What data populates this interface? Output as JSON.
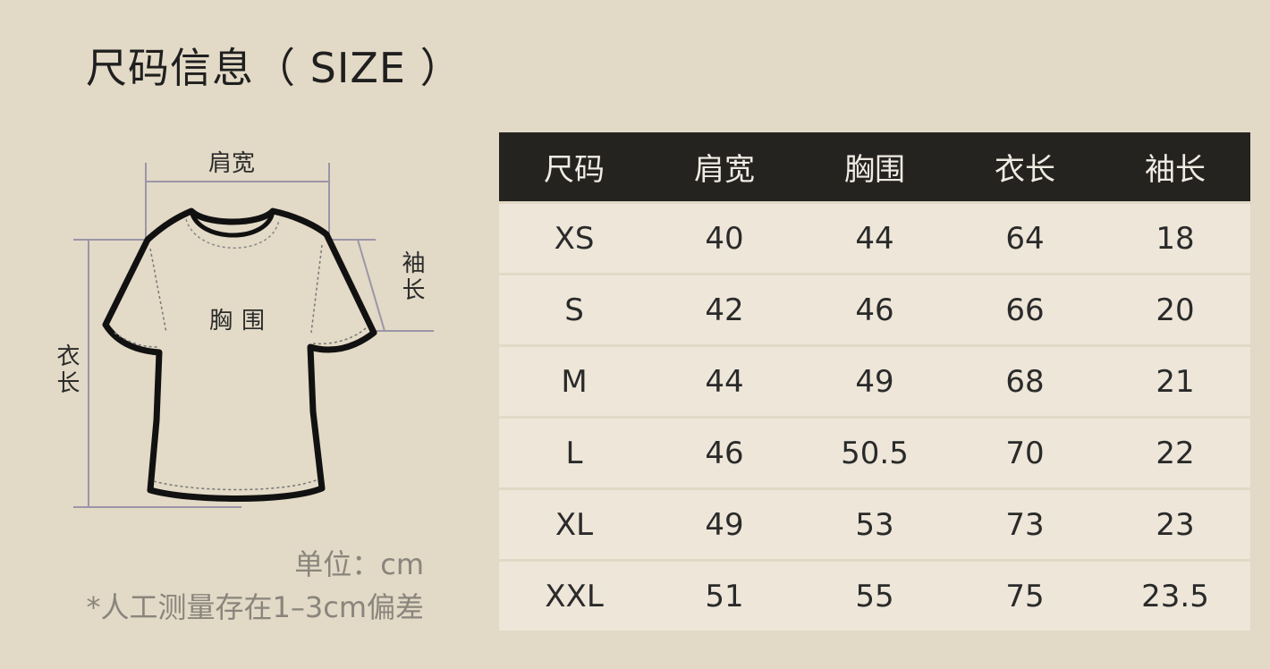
{
  "title": "尺码信息（ SIZE ）",
  "figure": {
    "shoulder_label": "肩宽",
    "sleeve_label": "袖长",
    "chest_label": "胸围",
    "length_label": "衣长"
  },
  "notes": {
    "unit": "单位：cm",
    "tolerance": "*人工测量存在1–3cm偏差"
  },
  "table": {
    "headers": [
      "尺码",
      "肩宽",
      "胸围",
      "衣长",
      "袖长"
    ],
    "rows": [
      [
        "XS",
        "40",
        "44",
        "64",
        "18"
      ],
      [
        "S",
        "42",
        "46",
        "66",
        "20"
      ],
      [
        "M",
        "44",
        "49",
        "68",
        "21"
      ],
      [
        "L",
        "46",
        "50.5",
        "70",
        "22"
      ],
      [
        "XL",
        "49",
        "53",
        "73",
        "23"
      ],
      [
        "XXL",
        "51",
        "55",
        "75",
        "23.5"
      ]
    ]
  },
  "colors": {
    "background": "#e2d9c6",
    "header_bg": "#252320",
    "row_bg": "#ede6d9"
  }
}
